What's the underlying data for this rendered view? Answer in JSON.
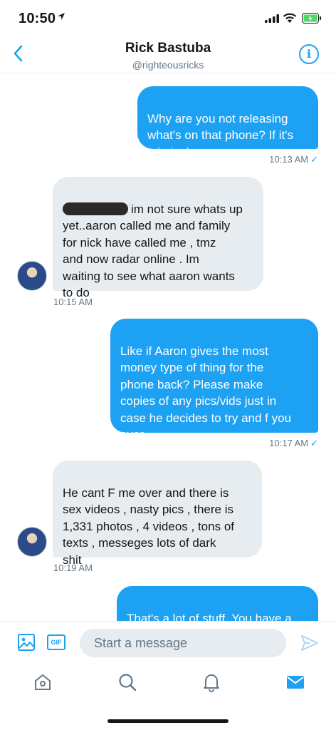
{
  "status_bar": {
    "time": "10:50"
  },
  "header": {
    "name": "Rick Bastuba",
    "handle": "@righteousricks"
  },
  "messages": [
    {
      "direction": "outgoing",
      "text": "Why are you not releasing\nwhat's on that phone? If it's\ncriminal ......",
      "time": "10:13 AM",
      "read_check": "✓"
    },
    {
      "direction": "incoming",
      "text": "im not sure whats up\nyet..aaron called me and family\nfor nick have called me , tmz\nand now radar online . Im\nwaiting to see what aaron wants\nto do",
      "time": "10:15 AM"
    },
    {
      "direction": "outgoing",
      "text": "Like if Aaron gives the most\nmoney type of thing for the\nphone back? Please make\ncopies of any pics/vids just in\ncase he decides to try and f you\nover",
      "time": "10:17 AM",
      "read_check": "✓"
    },
    {
      "direction": "incoming",
      "text": "He cant F me over and there is\nsex videos , nasty pics , there is\n1,331 photos , 4 videos , tons of\ntexts , messeges lots of dark\nshit",
      "time": "10:19 AM"
    },
    {
      "direction": "outgoing",
      "text": "That's a lot of stuff. You have a\nlot of power here"
    }
  ],
  "composer": {
    "placeholder": "Start a message",
    "gif_label": "GIF"
  },
  "tabs": [
    "home-icon",
    "search-icon",
    "notifications-icon",
    "messages-icon"
  ],
  "colors": {
    "accent": "#1da1f2",
    "incoming_bubble": "#e6ecf0",
    "battery": "#4cd964"
  }
}
